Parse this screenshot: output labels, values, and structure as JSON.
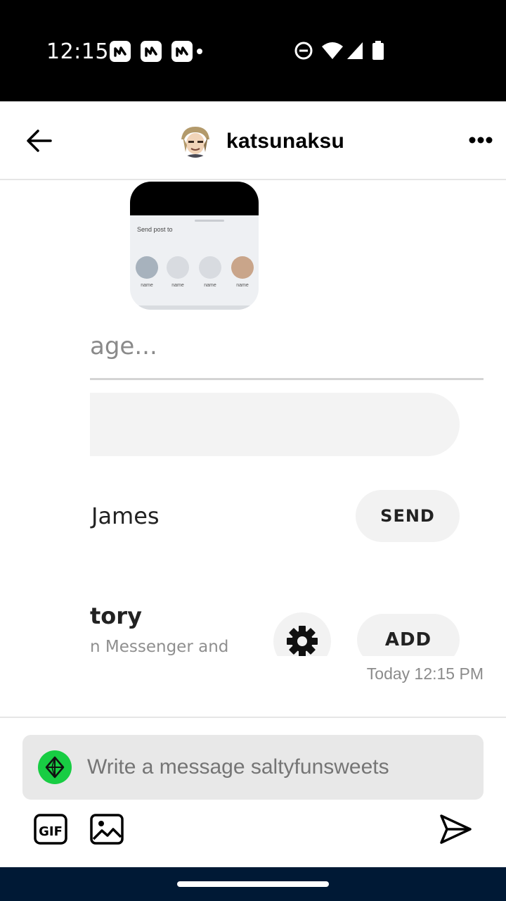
{
  "status_bar": {
    "time": "12:15",
    "notification_icons": [
      "app-notification-icon",
      "app-notification-icon",
      "app-notification-icon"
    ],
    "system_icons": [
      "do-not-disturb-icon",
      "wifi-icon",
      "cellular-signal-icon",
      "battery-icon"
    ]
  },
  "header": {
    "username": "katsunaksu",
    "back_icon": "back-arrow-icon",
    "more_icon": "more-options-icon"
  },
  "message": {
    "screenshot": {
      "input_fragment": "age...",
      "contact_name_fragment": "James",
      "send_label": "SEND",
      "story_fragment": "tory",
      "story_subtitle_fragment": "n Messenger and",
      "add_label": "ADD"
    },
    "timestamp": "Today 12:15 PM"
  },
  "compose": {
    "placeholder": "Write a message saltyfunsweets",
    "gif_icon": "gif-icon",
    "image_icon": "image-icon",
    "send_icon": "send-icon"
  },
  "colors": {
    "status_bar": "#000000",
    "nav_bar": "#001935",
    "compose_avatar": "#18cd43",
    "input_background": "#e8e8e8"
  }
}
